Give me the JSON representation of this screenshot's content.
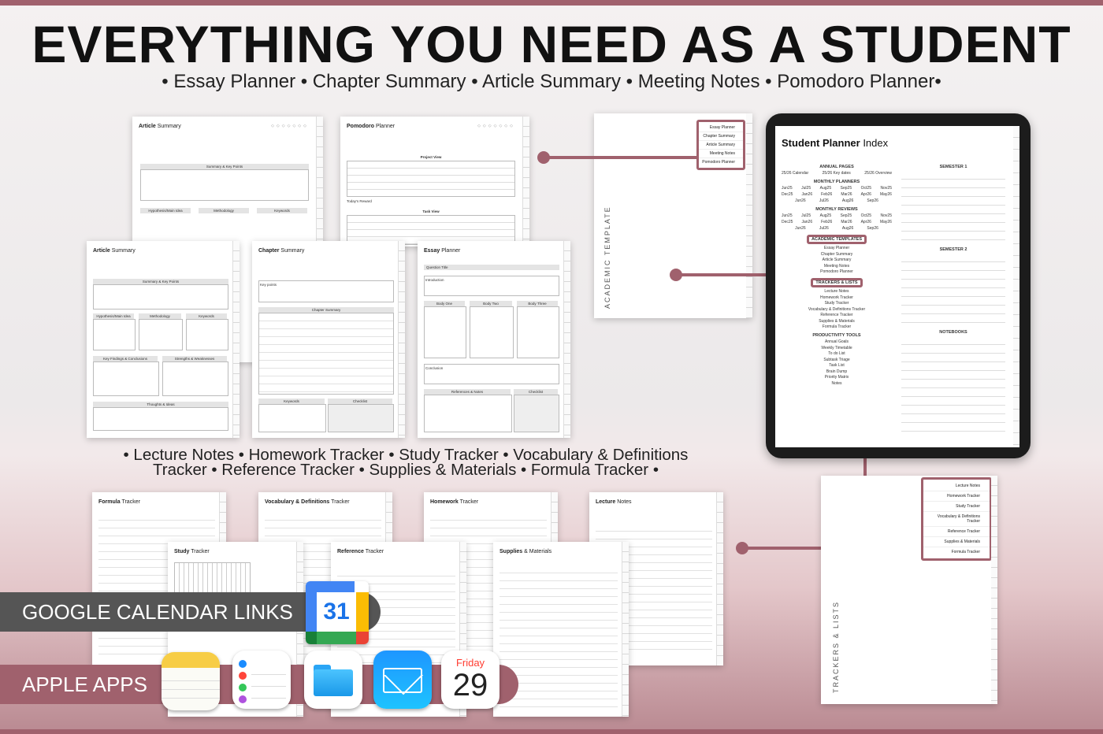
{
  "header": {
    "title": "EVERYTHING YOU NEED AS A STUDENT",
    "subtitle": "• Essay Planner • Chapter Summary • Article Summary • Meeting Notes • Pomodoro Planner•"
  },
  "trackers_caption": {
    "line1": "• Lecture Notes • Homework Tracker • Study Tracker • Vocabulary & Definitions",
    "line2": "Tracker • Reference Tracker • Supplies & Materials • Formula Tracker •"
  },
  "colors": {
    "accent": "#a0616d",
    "dark_pill": "#555555"
  },
  "back_pages": [
    {
      "title_a": "Article",
      "title_b": "Summary"
    },
    {
      "title_a": "Pomodoro",
      "title_b": "Planner"
    }
  ],
  "front_pages": [
    {
      "title_a": "Article",
      "title_b": "Summary"
    },
    {
      "title_a": "Chapter",
      "title_b": "Summary"
    },
    {
      "title_a": "Essay",
      "title_b": "Planner"
    }
  ],
  "article_page": {
    "summary_hdr": "Summary & Key Points",
    "hypothesis": "Hypothesis/Main Idea",
    "methodology": "Methodology",
    "keywords": "Keywords",
    "findings": "Key Findings & Conclusions",
    "strengths": "Strengths & Weaknesses",
    "thoughts": "Thoughts & Ideas"
  },
  "chapter_page": {
    "key_points": "Key points",
    "summary": "Chapter Summary",
    "keywords": "Keywords",
    "checklist": "Checklist"
  },
  "essay_page": {
    "question": "Question Title",
    "intro": "Introduction",
    "body1": "Body One",
    "body2": "Body Two",
    "body3": "Body Three",
    "conclusion": "Conclusion",
    "references": "References & Notes",
    "checklist": "Checklist"
  },
  "pomodoro_page": {
    "project_view": "Project View",
    "task_view": "Task View",
    "reward": "Today's Reward"
  },
  "tracker_pages": [
    {
      "title_a": "Formula",
      "title_b": "Tracker"
    },
    {
      "title_a": "Vocabulary & Definitions",
      "title_b": "Tracker"
    },
    {
      "title_a": "Homework",
      "title_b": "Tracker"
    },
    {
      "title_a": "Lecture",
      "title_b": "Notes"
    },
    {
      "title_a": "Study",
      "title_b": "Tracker"
    },
    {
      "title_a": "Reference",
      "title_b": "Tracker"
    },
    {
      "title_a": "Supplies",
      "title_b": "& Materials"
    }
  ],
  "academic_divider": {
    "vertical_label": "ACADEMIC TEMPLATE",
    "menu": [
      "Essay Planner",
      "Chapter Summary",
      "Article Summary",
      "Meeting Notes",
      "Pomodoro Planner"
    ]
  },
  "trackers_divider": {
    "vertical_label": "TRACKERS & LISTS",
    "menu": [
      "Lecture Notes",
      "Homework Tracker",
      "Study Tracker",
      "Vocabulary & Definitions Tracker",
      "Reference Tracker",
      "Supplies & Materials",
      "Formula Tracker"
    ]
  },
  "tablet": {
    "title_a": "Student Planner",
    "title_b": "Index",
    "annual_pages": "ANNUAL PAGES",
    "annual_items": [
      "25/26 Calendar",
      "25/26 Key dates",
      "25/26 Overview"
    ],
    "monthly_planners": "MONTHLY PLANNERS",
    "monthly_reviews": "MONTHLY REVIEWS",
    "months_row1": [
      "Jun25",
      "Jul25",
      "Aug25",
      "Sep25",
      "Oct25",
      "Nov25"
    ],
    "months_row2": [
      "Dec25",
      "Jan26",
      "Feb26",
      "Mar26",
      "Apr26",
      "May26"
    ],
    "months_row3": [
      "Jun26",
      "Jul26",
      "Aug26",
      "Sep26"
    ],
    "academic_templates": "ACADEMIC TEMPLATES",
    "academic_items": [
      "Essay Planner",
      "Chapter Summary",
      "Article Summary",
      "Meeting Notes",
      "Pomodoro Planner"
    ],
    "trackers_lists": "TRACKERS & LISTS",
    "tracker_items": [
      "Lecture Notes",
      "Homework Tracker",
      "Study Tracker",
      "Vocabulary & Definitions Tracker",
      "Reference Tracker",
      "Supplies & Materials",
      "Formula Tracker"
    ],
    "productivity_tools": "PRODUCTIVITY TOOLS",
    "productivity_items": [
      "Annual Goals",
      "Weekly Timetable",
      "To do List",
      "Subtask Triage",
      "Task List",
      "Brain Dump",
      "Priority Matrix",
      "Notes"
    ],
    "semester1": "SEMESTER 1",
    "semester2": "SEMESTER 2",
    "notebooks": "NOTEBOOKS"
  },
  "badges": {
    "google": "GOOGLE CALENDAR LINKS",
    "apple": "APPLE APPS",
    "calendar_number": "31",
    "apple_cal_day": "Friday",
    "apple_cal_date": "29"
  },
  "icons": [
    "google-calendar-icon",
    "notes-icon",
    "reminders-icon",
    "files-icon",
    "mail-icon",
    "calendar-icon"
  ]
}
